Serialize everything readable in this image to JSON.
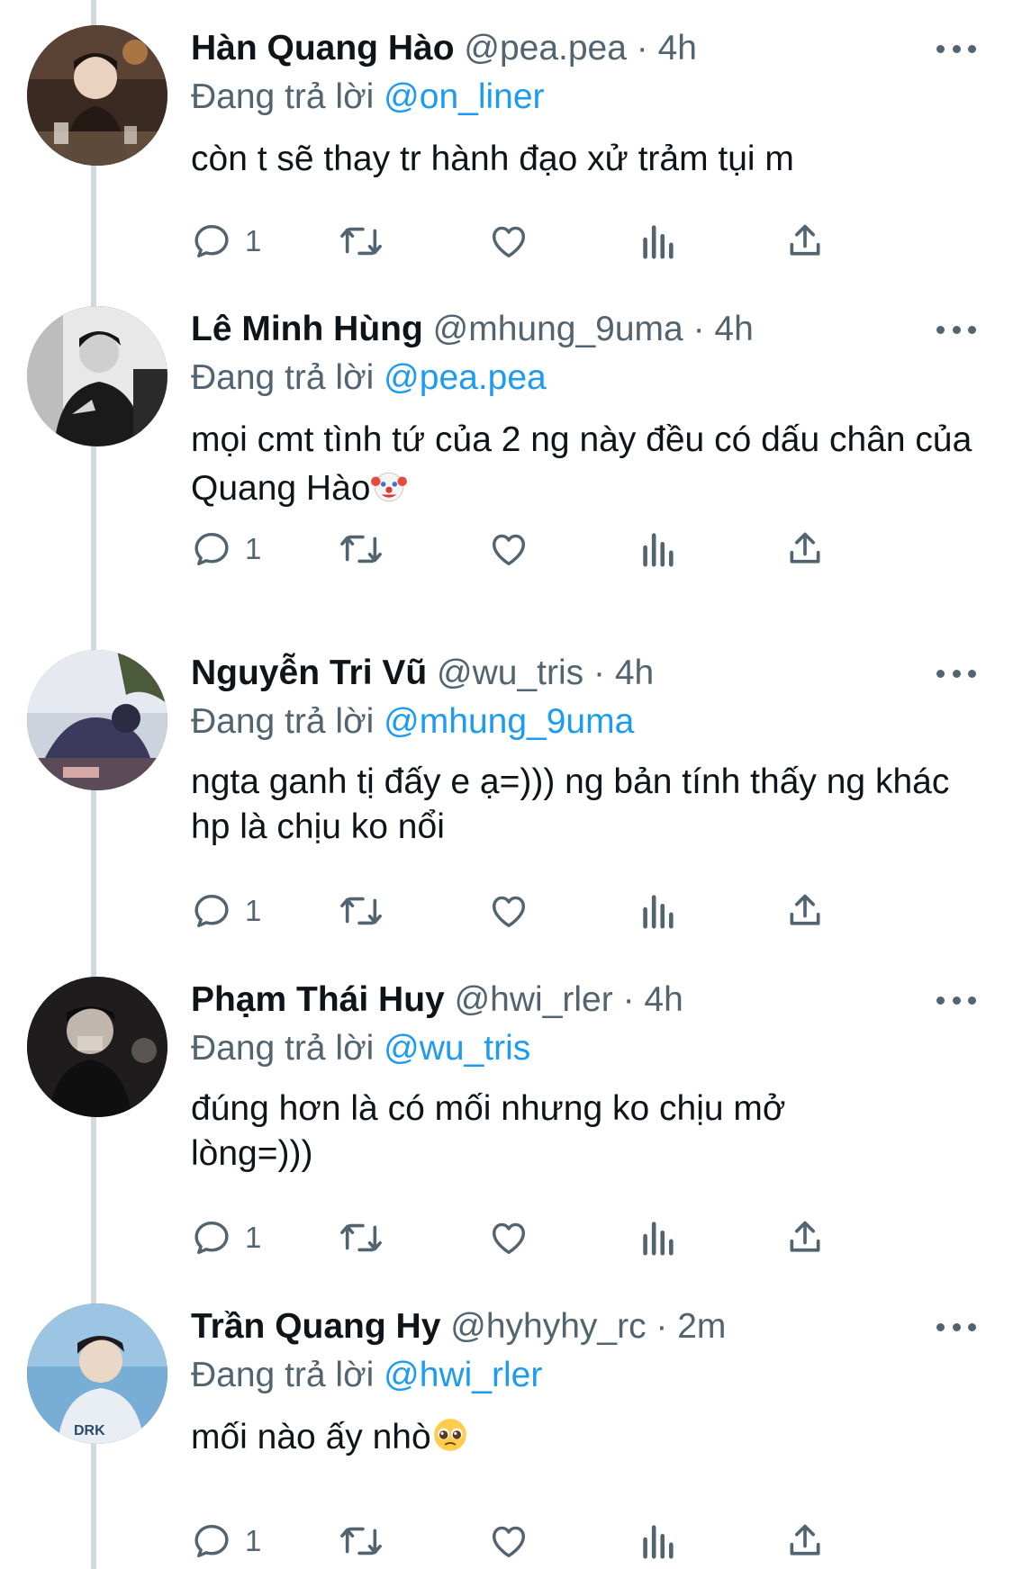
{
  "tweets": [
    {
      "name": "Hàn Quang Hào",
      "handle": "@pea.pea",
      "time": "· 4h",
      "replying_prefix": "Đang trả lời",
      "replying_to": "@on_liner",
      "text": "còn t sẽ thay tr hành đạo xử trảm tụi m",
      "reply_count": "1"
    },
    {
      "name": "Lê Minh Hùng",
      "handle": "@mhung_9uma",
      "time": "· 4h",
      "replying_prefix": "Đang trả lời",
      "replying_to": "@pea.pea",
      "text": "mọi cmt tình tứ của 2 ng này đều có dấu chân của Quang Hào",
      "reply_count": "1"
    },
    {
      "name": "Nguyễn Tri Vũ",
      "handle": "@wu_tris",
      "time": "· 4h",
      "replying_prefix": "Đang trả lời",
      "replying_to": "@mhung_9uma",
      "text": "ngta ganh tị đấy e ạ=))) ng bản tính thấy ng khác hp là chịu ko nổi",
      "reply_count": "1"
    },
    {
      "name": "Phạm Thái Huy",
      "handle": "@hwi_rler",
      "time": "· 4h",
      "replying_prefix": "Đang trả lời",
      "replying_to": "@wu_tris",
      "text": "đúng hơn là có mối nhưng ko chịu mở lòng=)))",
      "reply_count": "1"
    },
    {
      "name": "Trần Quang Hy",
      "handle": "@hyhyhy_rc",
      "time": "· 2m",
      "replying_prefix": "Đang trả lời",
      "replying_to": "@hwi_rler",
      "text": "mối nào ấy nhò",
      "reply_count": "1"
    }
  ],
  "icons": {
    "reply": "reply-icon",
    "retweet": "retweet-icon",
    "like": "heart-icon",
    "views": "views-chart-icon",
    "share": "share-icon",
    "more": "more-icon"
  },
  "colors": {
    "text": "#0f1419",
    "secondary": "#536471",
    "mention": "#1d9bf0",
    "thread_line": "#cfd9de"
  }
}
